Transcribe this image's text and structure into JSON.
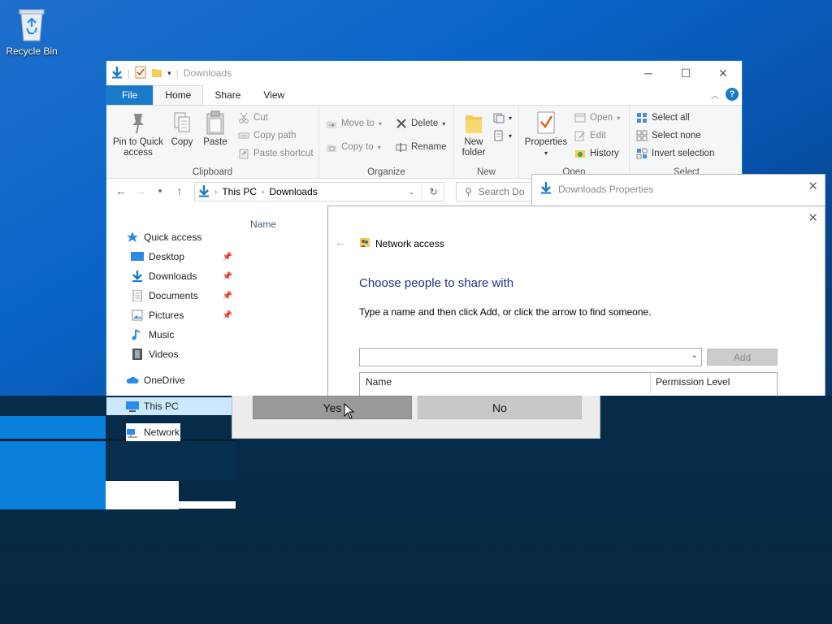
{
  "desktop": {
    "recycle_bin_label": "Recycle Bin"
  },
  "explorer": {
    "title": "Downloads",
    "tabs": [
      "File",
      "Home",
      "Share",
      "View"
    ],
    "ribbon": {
      "clipboard": {
        "pin_label": "Pin to Quick access",
        "copy_label": "Copy",
        "paste_label": "Paste",
        "cut_label": "Cut",
        "copy_path_label": "Copy path",
        "paste_shortcut_label": "Paste shortcut",
        "group_label": "Clipboard"
      },
      "organize": {
        "move_to_label": "Move to",
        "copy_to_label": "Copy to",
        "delete_label": "Delete",
        "rename_label": "Rename",
        "group_label": "Organize"
      },
      "new": {
        "new_folder_label": "New folder",
        "group_label": "New"
      },
      "open": {
        "properties_label": "Properties",
        "open_label": "Open",
        "edit_label": "Edit",
        "history_label": "History",
        "group_label": "Open"
      },
      "select": {
        "select_all_label": "Select all",
        "select_none_label": "Select none",
        "invert_label": "Invert selection",
        "group_label": "Select"
      }
    },
    "address": {
      "crumb1": "This PC",
      "crumb2": "Downloads",
      "search_placeholder": "Search Do"
    },
    "nav": {
      "quick_access": "Quick access",
      "desktop": "Desktop",
      "downloads": "Downloads",
      "documents": "Documents",
      "pictures": "Pictures",
      "music": "Music",
      "videos": "Videos",
      "onedrive": "OneDrive",
      "this_pc": "This PC",
      "network": "Network"
    },
    "column_name": "Name"
  },
  "properties_window": {
    "title": "Downloads Properties"
  },
  "network_dialog": {
    "header": "Network access",
    "heading": "Choose people to share with",
    "instruction": "Type a name and then click Add, or click the arrow to find someone.",
    "combo_value": "",
    "add_label": "Add",
    "col_name": "Name",
    "col_permission": "Permission Level"
  },
  "confirm_panel": {
    "yes_label": "Yes",
    "no_label": "No"
  },
  "colors": {
    "accent": "#1979ca",
    "heading_blue": "#1e3287",
    "selection": "#cce8ff"
  }
}
